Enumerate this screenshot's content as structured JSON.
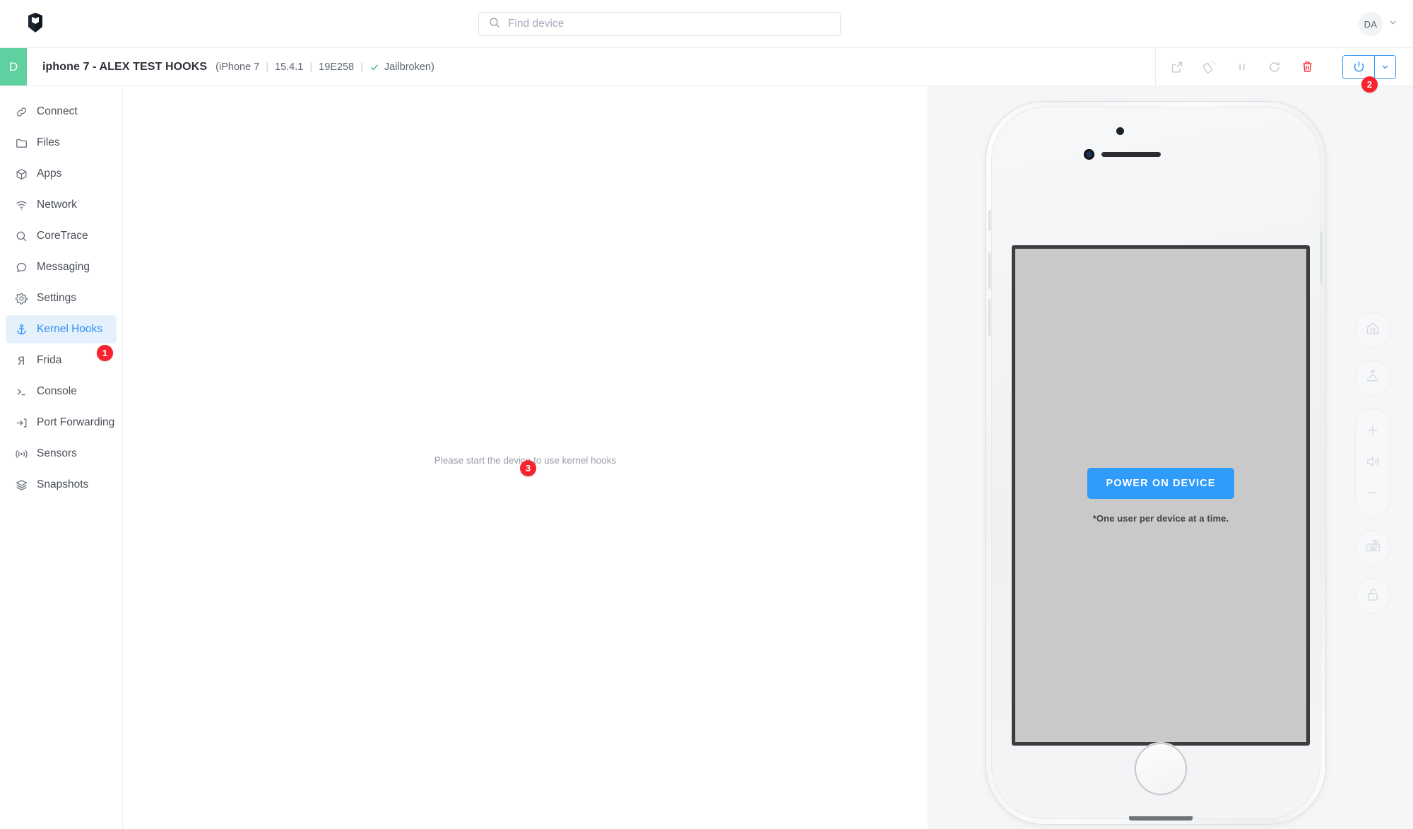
{
  "topbar": {
    "logo_icon": "corellium-logo-icon",
    "search": {
      "placeholder": "Find device",
      "value": "",
      "icon": "search-icon"
    },
    "user": {
      "initials": "DA",
      "caret_icon": "chevron-down-icon"
    }
  },
  "device_header": {
    "swatch_letter": "D",
    "title": "iphone 7 - ALEX TEST HOOKS",
    "open_paren": "(",
    "model": "iPhone 7",
    "os_version": "15.4.1",
    "build": "19E258",
    "separator": "|",
    "jailbreak_status": "Jailbroken)",
    "jailbreak_icon": "check-icon",
    "tools": [
      {
        "name": "open-external-button",
        "icon": "external-link-icon",
        "label": "Open in new window"
      },
      {
        "name": "rotate-device-button",
        "icon": "rotate-icon",
        "label": "Rotate"
      },
      {
        "name": "pause-device-button",
        "icon": "pause-icon",
        "label": "Pause"
      },
      {
        "name": "restart-device-button",
        "icon": "refresh-icon",
        "label": "Restart"
      },
      {
        "name": "delete-device-button",
        "icon": "trash-icon",
        "label": "Delete"
      }
    ],
    "power": {
      "icon": "power-icon",
      "caret_icon": "chevron-down-icon",
      "accent": "#3b9cf8"
    }
  },
  "badges": [
    {
      "id": "badge1",
      "text": "1",
      "color": "#f8232f"
    },
    {
      "id": "badge2",
      "text": "2",
      "color": "#f8232f"
    },
    {
      "id": "badge3",
      "text": "3",
      "color": "#f8232f"
    }
  ],
  "sidebar": {
    "items": [
      {
        "label": "Connect",
        "icon": "link-icon",
        "active": false
      },
      {
        "label": "Files",
        "icon": "folder-icon",
        "active": false
      },
      {
        "label": "Apps",
        "icon": "cube-icon",
        "active": false
      },
      {
        "label": "Network",
        "icon": "wifi-icon",
        "active": false
      },
      {
        "label": "CoreTrace",
        "icon": "search-icon",
        "active": false
      },
      {
        "label": "Messaging",
        "icon": "message-icon",
        "active": false
      },
      {
        "label": "Settings",
        "icon": "gear-icon",
        "active": false
      },
      {
        "label": "Kernel Hooks",
        "icon": "anchor-icon",
        "active": true
      },
      {
        "label": "Frida",
        "icon": "frida-icon",
        "active": false
      },
      {
        "label": "Console",
        "icon": "terminal-icon",
        "active": false
      },
      {
        "label": "Port Forwarding",
        "icon": "login-arrow-icon",
        "active": false
      },
      {
        "label": "Sensors",
        "icon": "signal-icon",
        "active": false
      },
      {
        "label": "Snapshots",
        "icon": "layers-icon",
        "active": false
      }
    ],
    "active_color": "#2f8ef4",
    "active_bg": "#e4f1fd"
  },
  "main": {
    "empty_message": "Please start the device to use kernel hooks"
  },
  "device_panel": {
    "power_on_label": "POWER ON DEVICE",
    "power_on_color": "#2f9bfa",
    "note": "*One user per device at a time.",
    "rail": [
      {
        "name": "home-button",
        "icon": "home-icon"
      },
      {
        "name": "brightness-button",
        "icon": "sunrise-icon"
      },
      {
        "name": "volume-up-button",
        "icon": "plus-icon"
      },
      {
        "name": "mute-button",
        "icon": "speaker-icon"
      },
      {
        "name": "volume-down-button",
        "icon": "minus-icon"
      },
      {
        "name": "keyboard-button",
        "icon": "keyboard-icon"
      },
      {
        "name": "lock-button",
        "icon": "unlock-icon"
      }
    ]
  }
}
